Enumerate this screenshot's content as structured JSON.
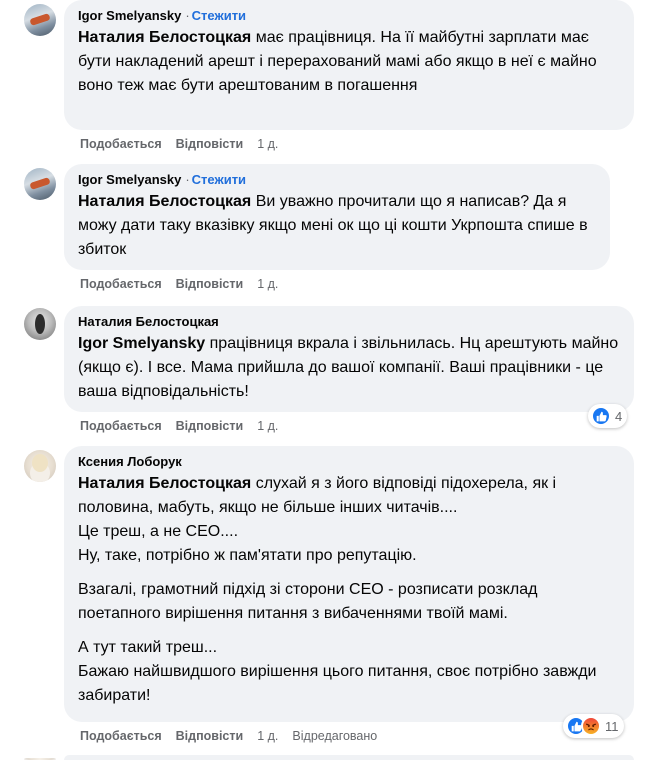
{
  "comments": [
    {
      "author": "Igor Smelyansky",
      "follow_label": "Стежити",
      "separator": "·",
      "mention": "Наталия Белостоцкая",
      "paragraphs": [
        "має працівниця. На її майбутні зарплати має бути накладений арешт і перерахований мамі або якщо в неї є майно воно теж має бути арештованим в погашення"
      ],
      "like_label": "Подобається",
      "reply_label": "Відповісти",
      "time": "1 д."
    },
    {
      "author": "Igor Smelyansky",
      "follow_label": "Стежити",
      "separator": "·",
      "mention": "Наталия Белостоцкая",
      "paragraphs": [
        "Ви уважно прочитали що я написав? Да я можу дати таку вказівку якщо мені ок що ці кошти Укрпошта спише в збиток"
      ],
      "like_label": "Подобається",
      "reply_label": "Відповісти",
      "time": "1 д."
    },
    {
      "author": "Наталия Белостоцкая",
      "mention": "Igor Smelyansky",
      "paragraphs": [
        "працівниця вкрала і звільнилась. Нц арештують майно (якщо є). І все. Мама прийшла до вашої компанії. Ваші працівники - це ваша відповідальність!"
      ],
      "like_label": "Подобається",
      "reply_label": "Відповісти",
      "time": "1 д.",
      "reaction_count": "4",
      "reaction_icons": [
        "like-icon"
      ]
    },
    {
      "author": "Ксения Лоборук",
      "mention": "Наталия Белостоцкая",
      "paragraphs": [
        "слухай я з його відповіді підохерела, як і половина, мабуть, якщо не більше інших читачів....",
        "Це треш, а не СЕО....",
        "Ну, таке, потрібно ж пам'ятати про репутацію.",
        "Взагалі, грамотний підхід зі сторони СЕО - розписати розклад поетапного вирішення питання з вибаченнями твоїй мамі.",
        "А тут такий треш...",
        "Бажаю найшвидшого вирішення цього питання, своє потрібно завжди забирати!"
      ],
      "like_label": "Подобається",
      "reply_label": "Відповісти",
      "time": "1 д.",
      "edited_label": "Відредаговано",
      "reaction_count": "11",
      "reaction_icons": [
        "like-icon",
        "angry-icon"
      ]
    }
  ],
  "colors": {
    "bubble": "#f0f2f5",
    "secondary_text": "#65676b",
    "follow_link": "#216fdb",
    "like_blue": "#1877f2"
  }
}
